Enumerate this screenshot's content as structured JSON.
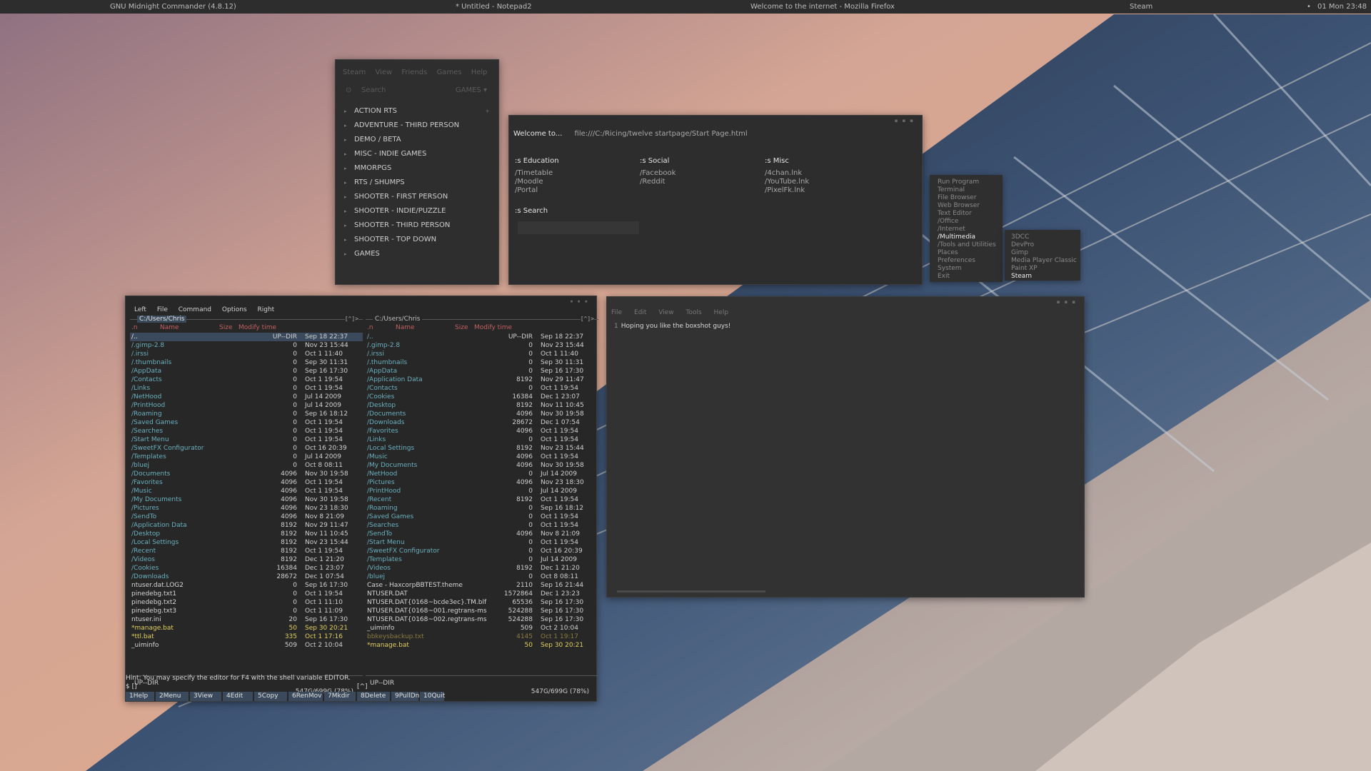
{
  "topbar": {
    "tasks": [
      "GNU Midnight Commander (4.8.12)",
      "* Untitled - Notepad2",
      "Welcome to the internet - Mozilla Firefox",
      "Steam"
    ],
    "clock": "01 Mon 23:48"
  },
  "steam": {
    "menu": [
      "Steam",
      "View",
      "Friends",
      "Games",
      "Help"
    ],
    "search_placeholder": "Search",
    "games_label": "GAMES",
    "categories": [
      "ACTION RTS",
      "ADVENTURE - THIRD PERSON",
      "DEMO / BETA",
      "MISC - INDIE GAMES",
      "MMORPGS",
      "RTS / SHUMPS",
      "SHOOTER - FIRST PERSON",
      "SHOOTER - INDIE/PUZZLE",
      "SHOOTER - THIRD PERSON",
      "SHOOTER - TOP DOWN",
      "GAMES"
    ]
  },
  "firefox": {
    "tab": "Welcome to...",
    "url": "file:///C:/Ricing/twelve startpage/Start Page.html",
    "sections": [
      {
        "title": ":s Education",
        "links": [
          "/Timetable",
          "/Moodle",
          "/Portal"
        ]
      },
      {
        "title": ":s Social",
        "links": [
          "/Facebook",
          "/Reddit"
        ]
      },
      {
        "title": ":s Misc",
        "links": [
          "/4chan.lnk",
          "/YouTube.lnk",
          "/PixelFk.lnk"
        ]
      }
    ],
    "search_title": ":s Search"
  },
  "obmenu": {
    "items": [
      "Run Program",
      "Terminal",
      "File Browser",
      "Web Browser",
      "Text Editor",
      "/Office",
      "/Internet",
      "/Multimedia",
      "/Tools and Utilities",
      "Places",
      "Preferences",
      "System",
      "Exit"
    ],
    "active": "/Multimedia",
    "submenu": [
      "3DCC",
      "DevPro",
      "Gimp",
      "Media Player Classic",
      "Paint XP",
      "Steam"
    ],
    "submenu_active": "Steam"
  },
  "notepad": {
    "menu": [
      "File",
      "Edit",
      "View",
      "Tools",
      "Help"
    ],
    "line_number": "1",
    "text": "Hoping you like the boxshot guys!"
  },
  "mc": {
    "menu": [
      "Left",
      "File",
      "Command",
      "Options",
      "Right"
    ],
    "left_path": "C:/Users/Chris",
    "right_path": "C:/Users/Chris",
    "corner": "[^]>",
    "hdr_q": ".n",
    "hdr_name": "Name",
    "hdr_size": "Size",
    "hdr_time": "Modify time",
    "left_rows": [
      {
        "n": "/..",
        "s": "UP--DIR",
        "t": "Sep 18 22:37",
        "k": "sel"
      },
      {
        "n": "/.gimp-2.8",
        "s": "0",
        "t": "Nov 23 15:44",
        "k": "dir"
      },
      {
        "n": "/.irssi",
        "s": "0",
        "t": "Oct  1 11:40",
        "k": "dir"
      },
      {
        "n": "/.thumbnails",
        "s": "0",
        "t": "Sep 30 11:31",
        "k": "dir"
      },
      {
        "n": "/AppData",
        "s": "0",
        "t": "Sep 16 17:30",
        "k": "dir"
      },
      {
        "n": "/Contacts",
        "s": "0",
        "t": "Oct  1 19:54",
        "k": "dir"
      },
      {
        "n": "/Links",
        "s": "0",
        "t": "Oct  1 19:54",
        "k": "dir"
      },
      {
        "n": "/NetHood",
        "s": "0",
        "t": "Jul 14  2009",
        "k": "dir"
      },
      {
        "n": "/PrintHood",
        "s": "0",
        "t": "Jul 14  2009",
        "k": "dir"
      },
      {
        "n": "/Roaming",
        "s": "0",
        "t": "Sep 16 18:12",
        "k": "dir"
      },
      {
        "n": "/Saved Games",
        "s": "0",
        "t": "Oct  1 19:54",
        "k": "dir"
      },
      {
        "n": "/Searches",
        "s": "0",
        "t": "Oct  1 19:54",
        "k": "dir"
      },
      {
        "n": "/Start Menu",
        "s": "0",
        "t": "Oct  1 19:54",
        "k": "dir"
      },
      {
        "n": "/SweetFX Configurator",
        "s": "0",
        "t": "Oct 16 20:39",
        "k": "dir"
      },
      {
        "n": "/Templates",
        "s": "0",
        "t": "Jul 14  2009",
        "k": "dir"
      },
      {
        "n": "/bluej",
        "s": "0",
        "t": "Oct  8 08:11",
        "k": "dir"
      },
      {
        "n": "/Documents",
        "s": "4096",
        "t": "Nov 30 19:58",
        "k": "dir"
      },
      {
        "n": "/Favorites",
        "s": "4096",
        "t": "Oct  1 19:54",
        "k": "dir"
      },
      {
        "n": "/Music",
        "s": "4096",
        "t": "Oct  1 19:54",
        "k": "dir"
      },
      {
        "n": "/My Documents",
        "s": "4096",
        "t": "Nov 30 19:58",
        "k": "dir"
      },
      {
        "n": "/Pictures",
        "s": "4096",
        "t": "Nov 23 18:30",
        "k": "dir"
      },
      {
        "n": "/SendTo",
        "s": "4096",
        "t": "Nov  8 21:09",
        "k": "dir"
      },
      {
        "n": "/Application Data",
        "s": "8192",
        "t": "Nov 29 11:47",
        "k": "dir"
      },
      {
        "n": "/Desktop",
        "s": "8192",
        "t": "Nov 11 10:45",
        "k": "dir"
      },
      {
        "n": "/Local Settings",
        "s": "8192",
        "t": "Nov 23 15:44",
        "k": "dir"
      },
      {
        "n": "/Recent",
        "s": "8192",
        "t": "Oct  1 19:54",
        "k": "dir"
      },
      {
        "n": "/Videos",
        "s": "8192",
        "t": "Dec  1 21:20",
        "k": "dir"
      },
      {
        "n": "/Cookies",
        "s": "16384",
        "t": "Dec  1 23:07",
        "k": "dir"
      },
      {
        "n": "/Downloads",
        "s": "28672",
        "t": "Dec  1 07:54",
        "k": "dir"
      },
      {
        "n": " ntuser.dat.LOG2",
        "s": "0",
        "t": "Sep 16 17:30",
        "k": "file"
      },
      {
        "n": " pinedebg.txt1",
        "s": "0",
        "t": "Oct  1 19:54",
        "k": "file"
      },
      {
        "n": " pinedebg.txt2",
        "s": "0",
        "t": "Oct  1 11:10",
        "k": "file"
      },
      {
        "n": " pinedebg.txt3",
        "s": "0",
        "t": "Oct  1 11:09",
        "k": "file"
      },
      {
        "n": " ntuser.ini",
        "s": "20",
        "t": "Sep 16 17:30",
        "k": "file"
      },
      {
        "n": "*manage.bat",
        "s": "50",
        "t": "Sep 30 20:21",
        "k": "exec"
      },
      {
        "n": "*ttl.bat",
        "s": "335",
        "t": "Oct  1 17:16",
        "k": "exec"
      },
      {
        "n": " _uiminfo",
        "s": "509",
        "t": "Oct  2 10:04",
        "k": "file"
      }
    ],
    "right_rows": [
      {
        "n": "/..",
        "s": "UP--DIR",
        "t": "Sep 18 22:37",
        "k": "dir"
      },
      {
        "n": "/.gimp-2.8",
        "s": "0",
        "t": "Nov 23 15:44",
        "k": "dir"
      },
      {
        "n": "/.irssi",
        "s": "0",
        "t": "Oct  1 11:40",
        "k": "dir"
      },
      {
        "n": "/.thumbnails",
        "s": "0",
        "t": "Sep 30 11:31",
        "k": "dir"
      },
      {
        "n": "/AppData",
        "s": "0",
        "t": "Sep 16 17:30",
        "k": "dir"
      },
      {
        "n": "/Application Data",
        "s": "8192",
        "t": "Nov 29 11:47",
        "k": "dir"
      },
      {
        "n": "/Contacts",
        "s": "0",
        "t": "Oct  1 19:54",
        "k": "dir"
      },
      {
        "n": "/Cookies",
        "s": "16384",
        "t": "Dec  1 23:07",
        "k": "dir"
      },
      {
        "n": "/Desktop",
        "s": "8192",
        "t": "Nov 11 10:45",
        "k": "dir"
      },
      {
        "n": "/Documents",
        "s": "4096",
        "t": "Nov 30 19:58",
        "k": "dir"
      },
      {
        "n": "/Downloads",
        "s": "28672",
        "t": "Dec  1 07:54",
        "k": "dir"
      },
      {
        "n": "/Favorites",
        "s": "4096",
        "t": "Oct  1 19:54",
        "k": "dir"
      },
      {
        "n": "/Links",
        "s": "0",
        "t": "Oct  1 19:54",
        "k": "dir"
      },
      {
        "n": "/Local Settings",
        "s": "8192",
        "t": "Nov 23 15:44",
        "k": "dir"
      },
      {
        "n": "/Music",
        "s": "4096",
        "t": "Oct  1 19:54",
        "k": "dir"
      },
      {
        "n": "/My Documents",
        "s": "4096",
        "t": "Nov 30 19:58",
        "k": "dir"
      },
      {
        "n": "/NetHood",
        "s": "0",
        "t": "Jul 14  2009",
        "k": "dir"
      },
      {
        "n": "/Pictures",
        "s": "4096",
        "t": "Nov 23 18:30",
        "k": "dir"
      },
      {
        "n": "/PrintHood",
        "s": "0",
        "t": "Jul 14  2009",
        "k": "dir"
      },
      {
        "n": "/Recent",
        "s": "8192",
        "t": "Oct  1 19:54",
        "k": "dir"
      },
      {
        "n": "/Roaming",
        "s": "0",
        "t": "Sep 16 18:12",
        "k": "dir"
      },
      {
        "n": "/Saved Games",
        "s": "0",
        "t": "Oct  1 19:54",
        "k": "dir"
      },
      {
        "n": "/Searches",
        "s": "0",
        "t": "Oct  1 19:54",
        "k": "dir"
      },
      {
        "n": "/SendTo",
        "s": "4096",
        "t": "Nov  8 21:09",
        "k": "dir"
      },
      {
        "n": "/Start Menu",
        "s": "0",
        "t": "Oct  1 19:54",
        "k": "dir"
      },
      {
        "n": "/SweetFX Configurator",
        "s": "0",
        "t": "Oct 16 20:39",
        "k": "dir"
      },
      {
        "n": "/Templates",
        "s": "0",
        "t": "Jul 14  2009",
        "k": "dir"
      },
      {
        "n": "/Videos",
        "s": "8192",
        "t": "Dec  1 21:20",
        "k": "dir"
      },
      {
        "n": "/bluej",
        "s": "0",
        "t": "Oct  8 08:11",
        "k": "dir"
      },
      {
        "n": " Case - HaxcorpBBTEST.theme",
        "s": "2110",
        "t": "Sep 16 21:44",
        "k": "file"
      },
      {
        "n": " NTUSER.DAT",
        "s": "1572864",
        "t": "Dec  1 23:23",
        "k": "file"
      },
      {
        "n": " NTUSER.DAT{0168~bcde3ec}.TM.blf",
        "s": "65536",
        "t": "Sep 16 17:30",
        "k": "file"
      },
      {
        "n": " NTUSER.DAT{0168~001.regtrans-ms",
        "s": "524288",
        "t": "Sep 16 17:30",
        "k": "file"
      },
      {
        "n": " NTUSER.DAT{0168~002.regtrans-ms",
        "s": "524288",
        "t": "Sep 16 17:30",
        "k": "file"
      },
      {
        "n": " _uiminfo",
        "s": "509",
        "t": "Oct  2 10:04",
        "k": "file"
      },
      {
        "n": " bbkeysbackup.txt",
        "s": "4145",
        "t": "Oct  1 19:17",
        "k": "bak"
      },
      {
        "n": "*manage.bat",
        "s": "50",
        "t": "Sep 30 20:21",
        "k": "exec"
      }
    ],
    "mini_left": "UP--DIR",
    "mini_right": "UP--DIR",
    "free_left": "547G/699G (78%)",
    "free_right": "547G/699G (78%)",
    "hint": "Hint: You may specify the editor for F4 with the shell variable EDITOR.",
    "prompt": "$ []",
    "prompt2": "[^]",
    "fkeys": [
      {
        "num": "1",
        "label": "Help"
      },
      {
        "num": "2",
        "label": "Menu"
      },
      {
        "num": "3",
        "label": "View"
      },
      {
        "num": "4",
        "label": "Edit"
      },
      {
        "num": "5",
        "label": "Copy"
      },
      {
        "num": "6",
        "label": "RenMov"
      },
      {
        "num": "7",
        "label": "Mkdir"
      },
      {
        "num": "8",
        "label": "Delete"
      },
      {
        "num": "9",
        "label": "PullDn"
      },
      {
        "num": "10",
        "label": "Quit"
      }
    ]
  }
}
